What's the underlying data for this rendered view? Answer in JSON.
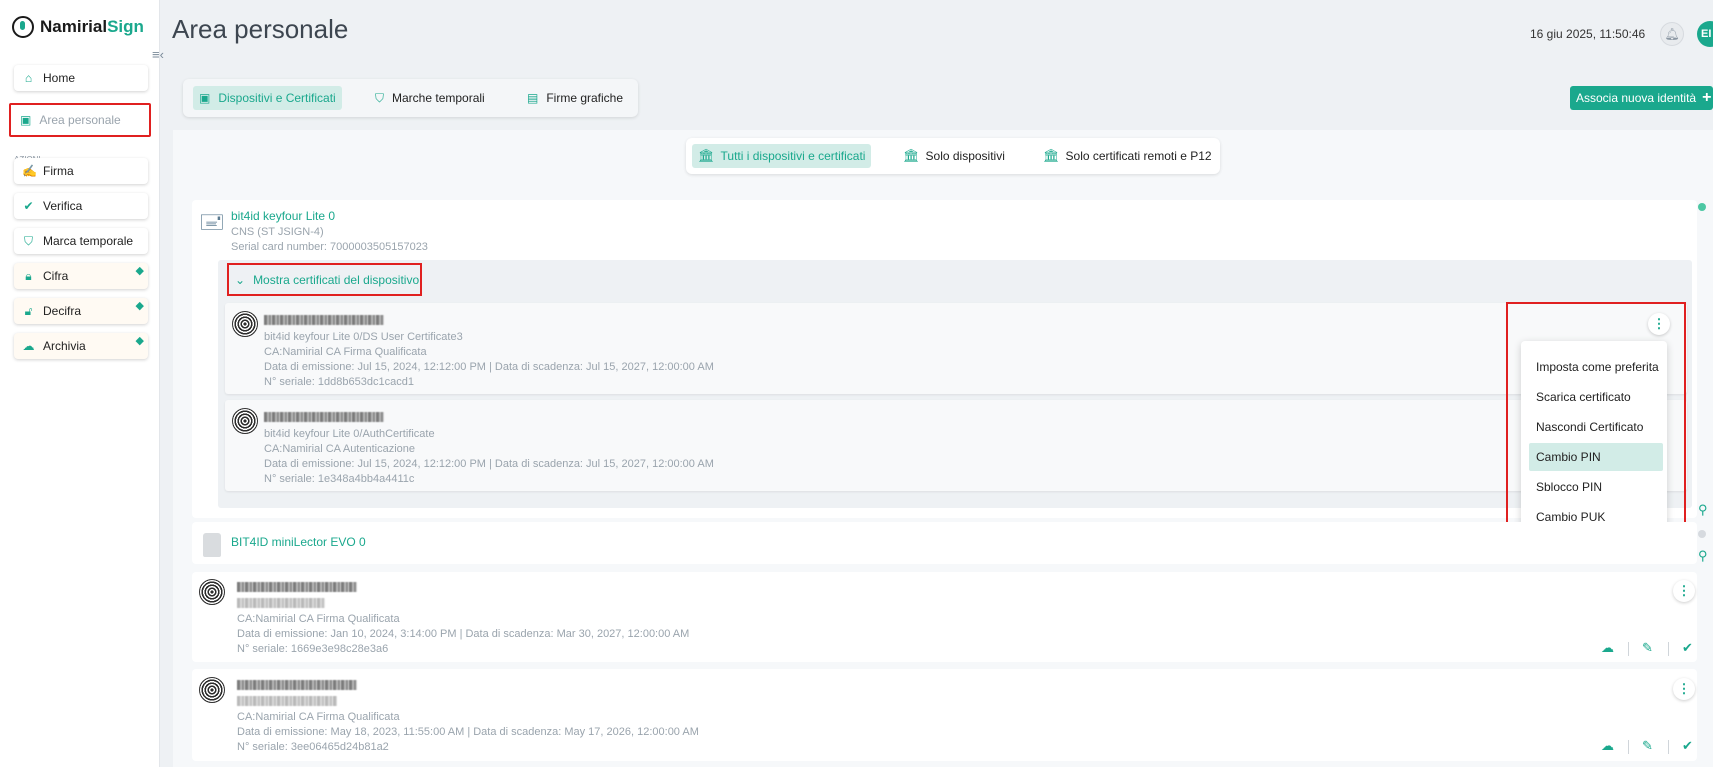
{
  "app": {
    "logo_text_1": "Namirial",
    "logo_text_2": "Sign",
    "page_title": "Area personale",
    "datetime": "16 giu 2025, 11:50:46",
    "avatar_initials": "EI"
  },
  "sidebar": {
    "home": "Home",
    "area_personale": "Area personale",
    "section_label": "AZIONI",
    "firma": "Firma",
    "verifica": "Verifica",
    "marca_temporale": "Marca temporale",
    "cifra": "Cifra",
    "decifra": "Decifra",
    "archivia": "Archivia"
  },
  "tabs": {
    "dispositivi": "Dispositivi e Certificati",
    "marche": "Marche temporali",
    "firme": "Firme grafiche"
  },
  "assoc_button": "Associa nuova identità",
  "filters": {
    "tutti": "Tutti i dispositivi e certificati",
    "solo_dispositivi": "Solo dispositivi",
    "solo_remoti": "Solo certificati remoti e P12"
  },
  "device1": {
    "name": "bit4id keyfour Lite 0",
    "type": "CNS (ST JSIGN-4)",
    "serial": "Serial card number: 7000003505157023",
    "expander_label": "Mostra certificati del dispositivo",
    "certs": [
      {
        "subtitle": "bit4id keyfour Lite 0/DS User Certificate3",
        "ca": "CA:Namirial CA Firma Qualificata",
        "dates": "Data di emissione: Jul 15, 2024, 12:12:00 PM | Data di scadenza: Jul 15, 2027, 12:00:00 AM",
        "serial": "N° seriale: 1dd8b653dc1cacd1"
      },
      {
        "subtitle": "bit4id keyfour Lite 0/AuthCertificate",
        "ca": "CA:Namirial CA Autenticazione",
        "dates": "Data di emissione: Jul 15, 2024, 12:12:00 PM | Data di scadenza: Jul 15, 2027, 12:00:00 AM",
        "serial": "N° seriale: 1e348a4bb4a4411c"
      }
    ]
  },
  "context_menu": {
    "items": [
      "Imposta come preferita",
      "Scarica certificato",
      "Nascondi Certificato",
      "Cambio PIN",
      "Sblocco PIN",
      "Cambio PUK"
    ],
    "highlighted": "Cambio PIN"
  },
  "device2": {
    "name": "BIT4ID miniLector EVO 0"
  },
  "remote_certs": [
    {
      "ca": "CA:Namirial CA Firma Qualificata",
      "dates": "Data di emissione: Jan 10, 2024, 3:14:00 PM | Data di scadenza: Mar 30, 2027, 12:00:00 AM",
      "serial": "N° seriale: 1669e3e98c28e3a6"
    },
    {
      "ca": "CA:Namirial CA Firma Qualificata",
      "dates": "Data di emissione: May 18, 2023, 11:55:00 AM | Data di scadenza: May 17, 2026, 12:00:00 AM",
      "serial": "N° seriale: 3ee06465d24b81a2"
    }
  ],
  "colors": {
    "accent": "#1aa88d",
    "highlight": "#d2ece7",
    "annotation_red": "#e02020"
  }
}
